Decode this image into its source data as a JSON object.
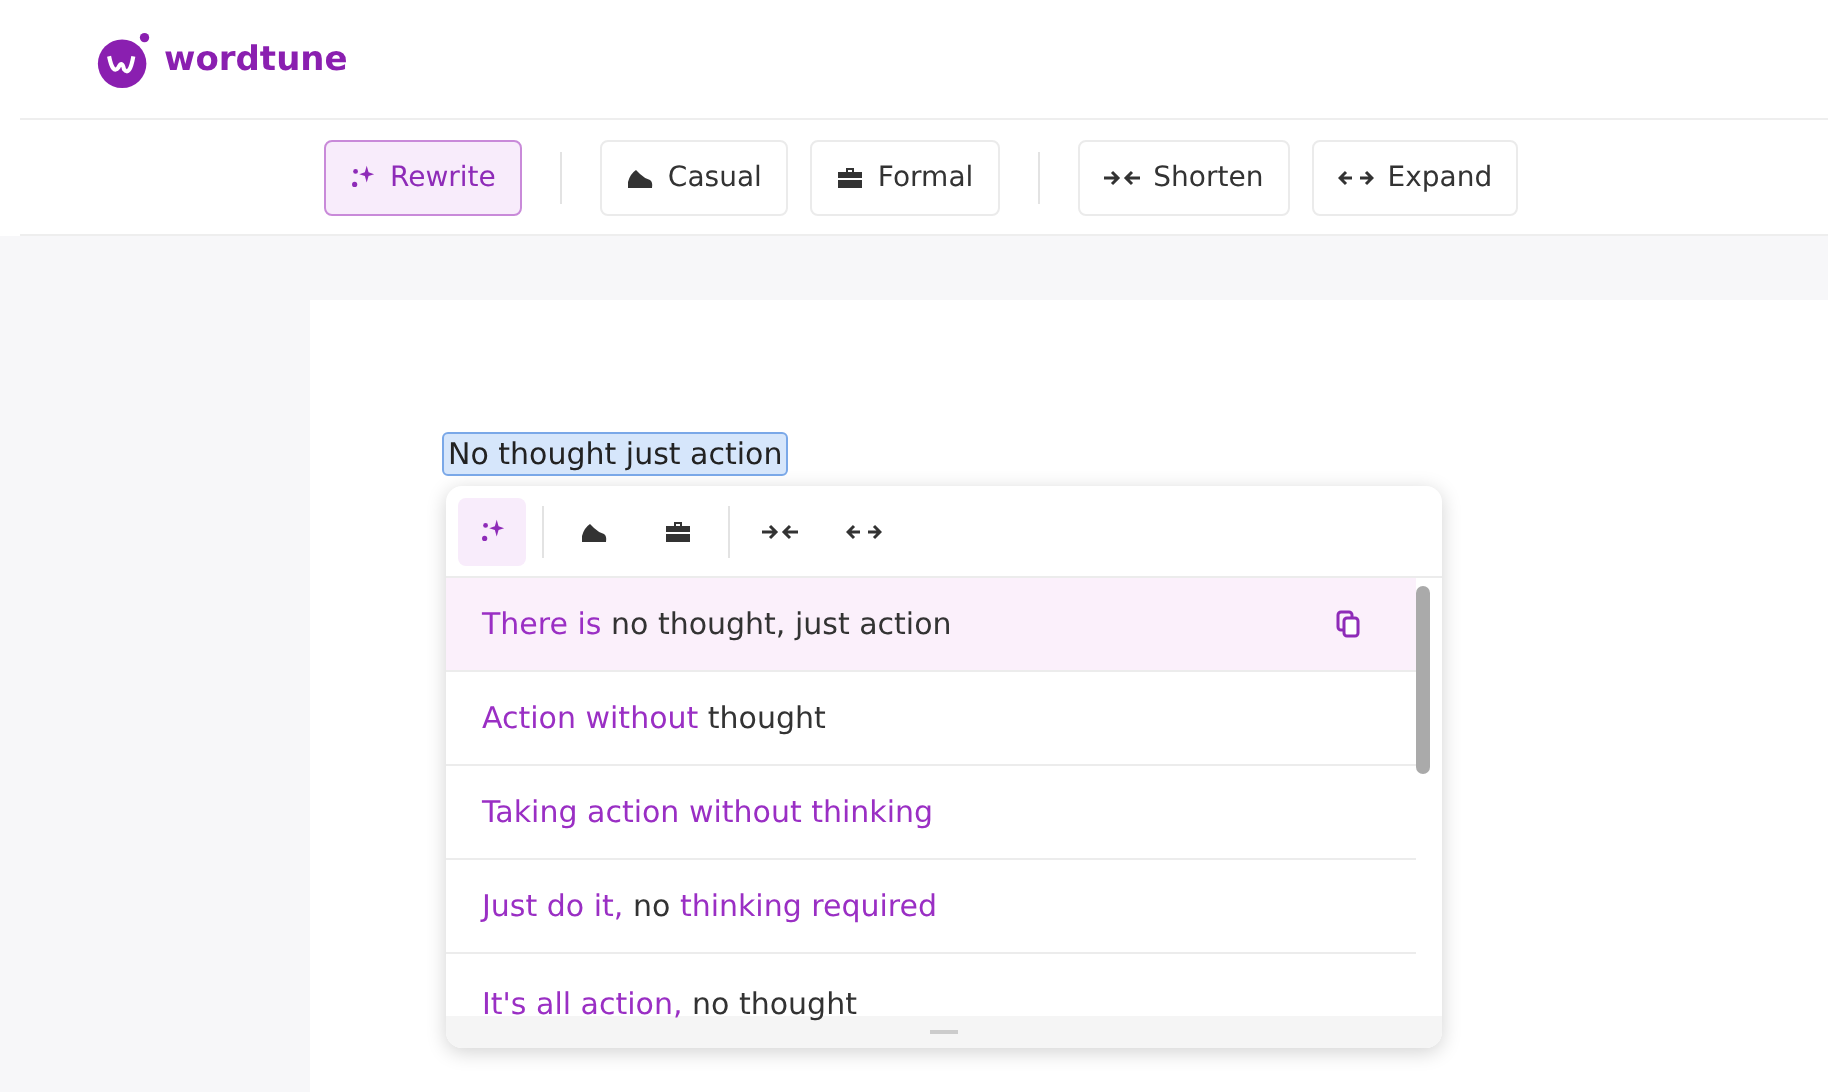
{
  "app": {
    "name": "wordtune"
  },
  "toolbar": [
    {
      "kind": "rewrite",
      "label": "Rewrite",
      "selected": true
    },
    {
      "kind": "casual",
      "label": "Casual",
      "selected": false
    },
    {
      "kind": "formal",
      "label": "Formal",
      "selected": false
    },
    {
      "kind": "shorten",
      "label": "Shorten",
      "selected": false
    },
    {
      "kind": "expand",
      "label": "Expand",
      "selected": false
    }
  ],
  "document": {
    "selected_text": "No thought just action"
  },
  "popup": {
    "tools": [
      {
        "kind": "rewrite",
        "selected": true
      },
      {
        "kind": "casual",
        "selected": false
      },
      {
        "kind": "formal",
        "selected": false
      },
      {
        "kind": "shorten",
        "selected": false
      },
      {
        "kind": "expand",
        "selected": false
      }
    ],
    "suggestions": [
      {
        "selected": true,
        "parts": [
          {
            "text": "There is",
            "changed": true
          },
          {
            "text": "no thought, just action",
            "changed": false
          }
        ]
      },
      {
        "selected": false,
        "parts": [
          {
            "text": "Action without",
            "changed": true
          },
          {
            "text": "thought",
            "changed": false
          }
        ]
      },
      {
        "selected": false,
        "parts": [
          {
            "text": "Taking action without thinking",
            "changed": true
          }
        ]
      },
      {
        "selected": false,
        "parts": [
          {
            "text": "Just do it,",
            "changed": true
          },
          {
            "text": "no",
            "changed": false
          },
          {
            "text": "thinking required",
            "changed": true
          }
        ]
      },
      {
        "selected": false,
        "parts": [
          {
            "text": "It's all action,",
            "changed": true
          },
          {
            "text": "no thought",
            "changed": false
          }
        ]
      }
    ]
  }
}
